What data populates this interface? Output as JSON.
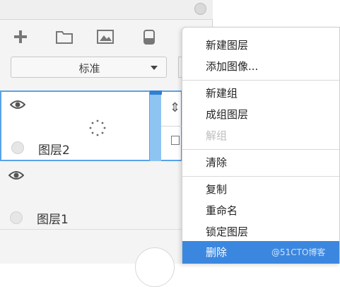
{
  "blend_mode": {
    "selected": "标准"
  },
  "layers": [
    {
      "name": "图层2"
    },
    {
      "name": "图层1"
    }
  ],
  "context_menu": {
    "items": [
      {
        "label": "新建图层"
      },
      {
        "label": "添加图像..."
      },
      {
        "label": "新建组"
      },
      {
        "label": "成组图层"
      },
      {
        "label": "解组"
      },
      {
        "label": "清除"
      },
      {
        "label": "复制"
      },
      {
        "label": "重命名"
      },
      {
        "label": "锁定图层"
      },
      {
        "label": "删除"
      }
    ],
    "watermark": "@51CTO博客"
  },
  "icons": {
    "add": "plus-icon",
    "folder": "folder-icon",
    "image": "image-icon",
    "mask": "mask-icon",
    "visibility": "eye-icon"
  },
  "colors": {
    "selection_border": "#5aa3e8",
    "menu_highlight": "#3b87e0"
  }
}
